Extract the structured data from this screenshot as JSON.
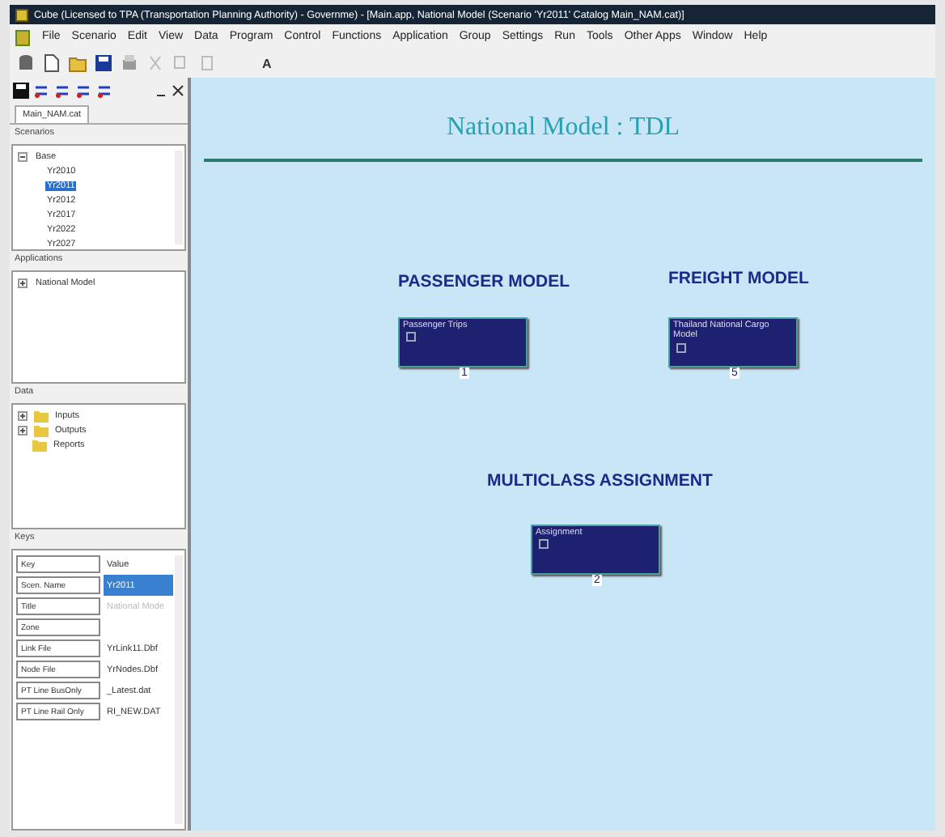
{
  "window": {
    "title": "Cube (Licensed to TPA (Transportation Planning Authority) - Governme) - [Main.app, National Model (Scenario 'Yr2011' Catalog Main_NAM.cat)]"
  },
  "menu": [
    "File",
    "Scenario",
    "Edit",
    "View",
    "Data",
    "Program",
    "Control",
    "Functions",
    "Application",
    "Group",
    "Settings",
    "Run",
    "Tools",
    "Other Apps",
    "Window",
    "Help"
  ],
  "toolbar": {
    "label": "A"
  },
  "sidebar": {
    "tab": "Main_NAM.cat",
    "scenarios": {
      "title": "Scenarios",
      "items": [
        {
          "label": "Base",
          "expanded": true,
          "children": [
            {
              "label": "Yr2010",
              "selected": false
            },
            {
              "label": "Yr2011",
              "selected": true
            },
            {
              "label": "Yr2012",
              "selected": false
            },
            {
              "label": "Yr2017",
              "selected": false
            },
            {
              "label": "Yr2022",
              "selected": false
            },
            {
              "label": "Yr2027",
              "selected": false
            }
          ]
        }
      ]
    },
    "applications": {
      "title": "Applications",
      "items": [
        {
          "label": "National Model",
          "expanded": false
        }
      ]
    },
    "data": {
      "title": "Data",
      "items": [
        {
          "label": "Inputs",
          "expanded": false
        },
        {
          "label": "Outputs",
          "expanded": false
        },
        {
          "label": "Reports"
        }
      ]
    },
    "keys": {
      "title": "Keys",
      "columns": [
        "Key",
        "Value"
      ],
      "rows": [
        {
          "key": "Scen. Name",
          "value": "Yr2011",
          "selected": true,
          "dimmed": false
        },
        {
          "key": "Title",
          "value": "National Mode",
          "selected": false,
          "dimmed": true
        },
        {
          "key": "Zone",
          "selected": false
        },
        {
          "key": "Link File",
          "value": "YrLink11.Dbf",
          "selected": false,
          "dimmed": false
        },
        {
          "key": "Node File",
          "value": "YrNodes.Dbf",
          "selected": false,
          "dimmed": false
        },
        {
          "key": "PT Line BusOnly",
          "value": "_Latest.dat",
          "selected": false,
          "dimmed": false
        },
        {
          "key": "PT Line Rail Only",
          "value": "RI_NEW.DAT",
          "selected": false,
          "dimmed": false
        }
      ]
    }
  },
  "canvas": {
    "title": "National Model  : TDL",
    "groups": [
      {
        "heading": "PASSENGER MODEL",
        "node": {
          "label": "Passenger Trips",
          "number": "1"
        }
      },
      {
        "heading": "FREIGHT MODEL",
        "node": {
          "label": "Thailand National Cargo Model",
          "number": "5"
        }
      },
      {
        "heading": "MULTICLASS ASSIGNMENT",
        "node": {
          "label": "Assignment",
          "number": "2"
        }
      }
    ]
  }
}
